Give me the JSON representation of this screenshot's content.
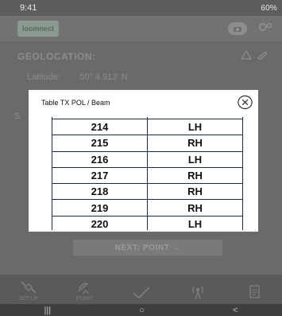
{
  "status_bar": {
    "time": "9:41",
    "right": "60%"
  },
  "header": {
    "logo_text": "loomnect"
  },
  "background": {
    "geolocation_label": "GEOLOCATION:",
    "latitude_label": "Latitude:",
    "latitude_value": "50° 4.913' N",
    "side_letter": "S",
    "next_button": "NEXT: POINT →"
  },
  "tabs": [
    {
      "label": "SET UP",
      "icon": "satellite-icon"
    },
    {
      "label": "POINT",
      "icon": "dish-icon"
    },
    {
      "label": "",
      "icon": "check-icon"
    },
    {
      "label": "",
      "icon": "antenna-icon"
    },
    {
      "label": "",
      "icon": "document-icon"
    }
  ],
  "modal": {
    "title": "Table TX POL / Beam",
    "rows": [
      {
        "beam": "214",
        "pol": "LH"
      },
      {
        "beam": "215",
        "pol": "RH"
      },
      {
        "beam": "216",
        "pol": "LH"
      },
      {
        "beam": "217",
        "pol": "RH"
      },
      {
        "beam": "218",
        "pol": "RH"
      },
      {
        "beam": "219",
        "pol": "RH"
      },
      {
        "beam": "220",
        "pol": "LH"
      }
    ]
  },
  "nav": {
    "recents": "|||",
    "home": "○",
    "back": "<"
  }
}
